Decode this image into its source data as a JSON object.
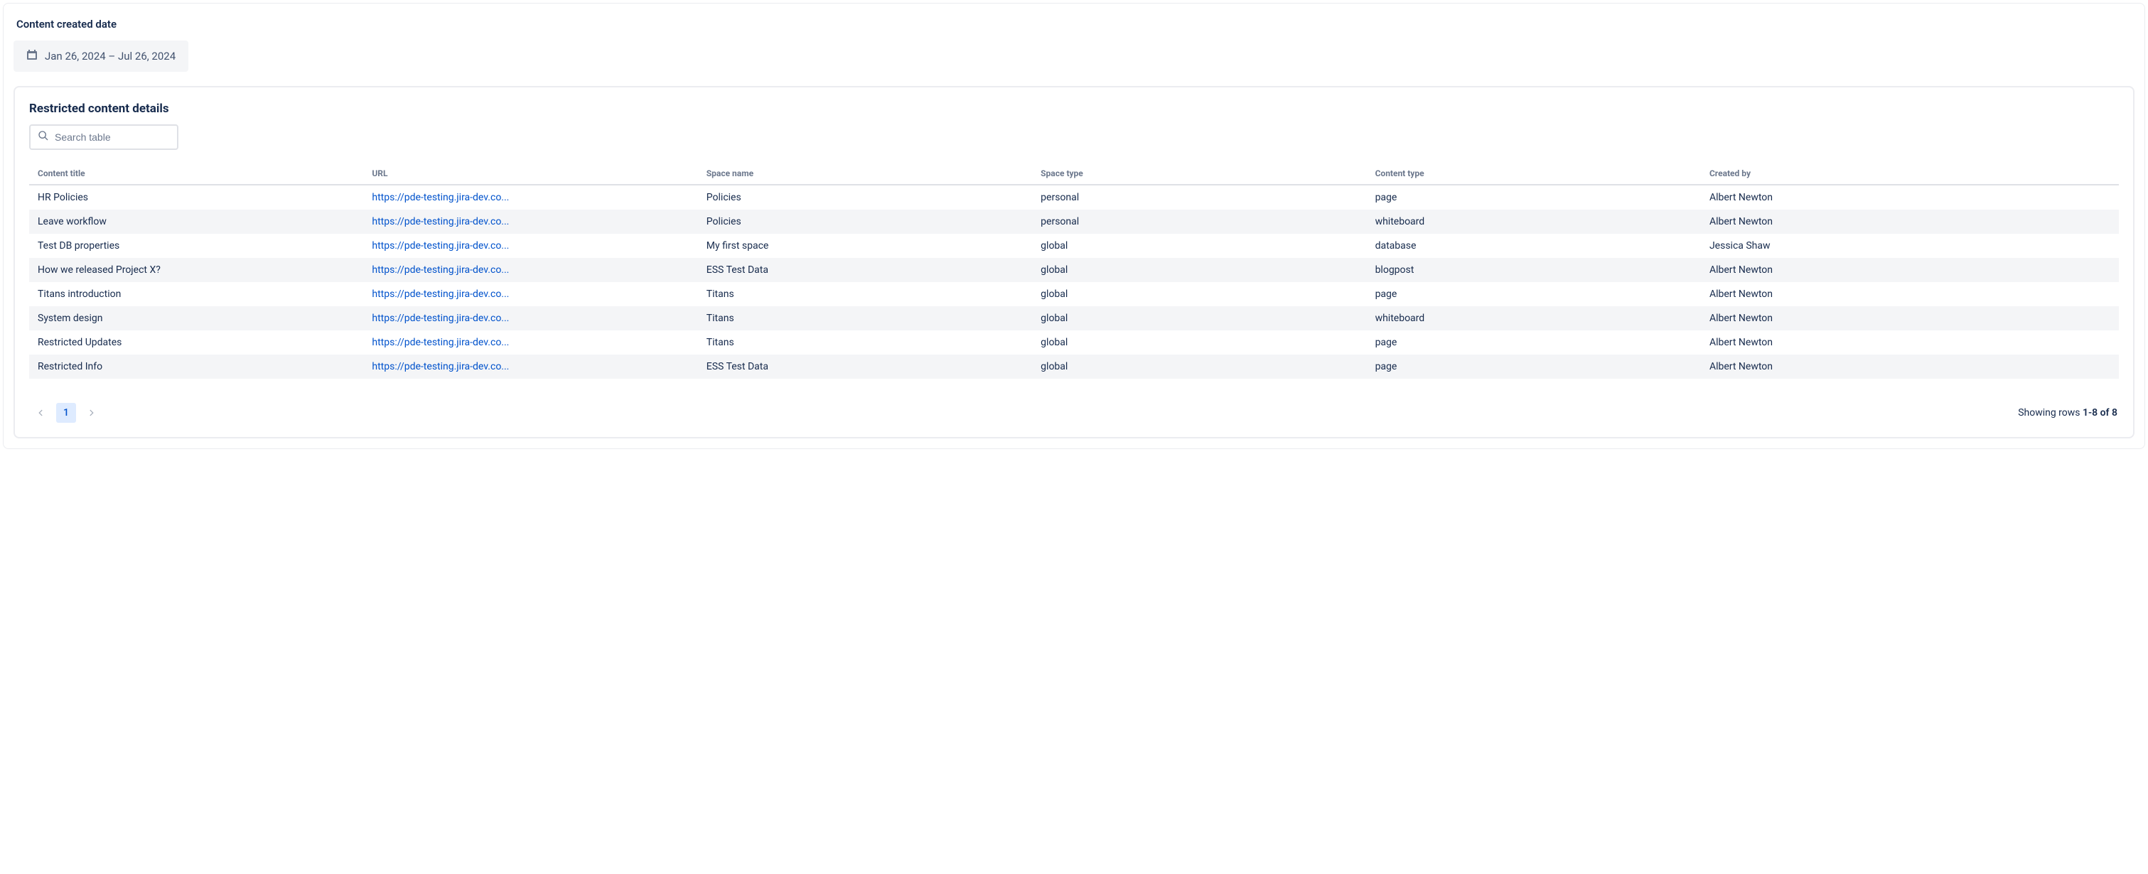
{
  "filter": {
    "label": "Content created date",
    "range_text": "Jan 26, 2024  –  Jul 26, 2024"
  },
  "card": {
    "title": "Restricted content details",
    "search_placeholder": "Search table"
  },
  "table": {
    "headers": {
      "content_title": "Content title",
      "url": "URL",
      "space_name": "Space name",
      "space_type": "Space type",
      "content_type": "Content type",
      "created_by": "Created by"
    },
    "rows": [
      {
        "title": "HR Policies",
        "url": "https://pde-testing.jira-dev.co...",
        "space": "Policies",
        "stype": "personal",
        "ctype": "page",
        "creator": "Albert Newton"
      },
      {
        "title": "Leave workflow",
        "url": "https://pde-testing.jira-dev.co...",
        "space": "Policies",
        "stype": "personal",
        "ctype": "whiteboard",
        "creator": "Albert Newton"
      },
      {
        "title": "Test DB properties",
        "url": "https://pde-testing.jira-dev.co...",
        "space": "My first space",
        "stype": "global",
        "ctype": "database",
        "creator": "Jessica Shaw"
      },
      {
        "title": "How we released Project X?",
        "url": "https://pde-testing.jira-dev.co...",
        "space": "ESS Test Data",
        "stype": "global",
        "ctype": "blogpost",
        "creator": "Albert Newton"
      },
      {
        "title": "Titans introduction",
        "url": "https://pde-testing.jira-dev.co...",
        "space": "Titans",
        "stype": "global",
        "ctype": "page",
        "creator": "Albert Newton"
      },
      {
        "title": "System design",
        "url": "https://pde-testing.jira-dev.co...",
        "space": "Titans",
        "stype": "global",
        "ctype": "whiteboard",
        "creator": "Albert Newton"
      },
      {
        "title": "Restricted Updates",
        "url": "https://pde-testing.jira-dev.co...",
        "space": "Titans",
        "stype": "global",
        "ctype": "page",
        "creator": "Albert Newton"
      },
      {
        "title": "Restricted Info",
        "url": "https://pde-testing.jira-dev.co...",
        "space": "ESS Test Data",
        "stype": "global",
        "ctype": "page",
        "creator": "Albert Newton"
      }
    ]
  },
  "pagination": {
    "current_page": "1",
    "showing_prefix": "Showing rows ",
    "showing_range": "1-8 of 8"
  }
}
